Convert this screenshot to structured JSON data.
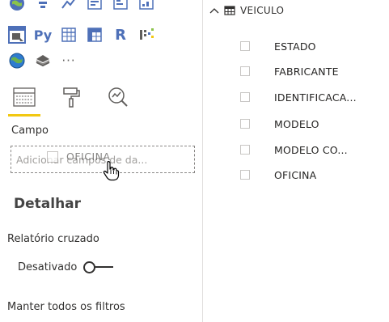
{
  "visualizations": {
    "row1": [
      "map-icon",
      "funnel-icon",
      "key-influencers-icon",
      "card-icon",
      "multirow-card-icon",
      "kpi-icon"
    ],
    "row2": [
      "slicer-icon",
      "python-visual-icon",
      "table-icon",
      "matrix-icon",
      "r-visual-icon",
      "decomposition-tree-icon"
    ],
    "row3": [
      "arcgis-map-icon",
      "shape-map-icon",
      "more-visuals-icon"
    ],
    "py_label": "Py",
    "r_label": "R",
    "more_label": "···"
  },
  "tabs": [
    {
      "name": "fields-tab",
      "icon": "fields-icon"
    },
    {
      "name": "format-tab",
      "icon": "paint-roller-icon"
    },
    {
      "name": "analytics-tab",
      "icon": "magnifier-chart-icon"
    }
  ],
  "field_well": {
    "label": "Campo",
    "placeholder": "Adicionar campos de da...",
    "drag_item": "OFICINA"
  },
  "drillthrough": {
    "title": "Detalhar",
    "cross_report_label": "Relatório cruzado",
    "toggle_label": "Desativado",
    "keep_filters_label": "Manter todos os filtros"
  },
  "fields_pane": {
    "table_name": "VEICULO",
    "fields": [
      {
        "label": "ESTADO"
      },
      {
        "label": "FABRICANTE"
      },
      {
        "label": "IDENTIFICACA..."
      },
      {
        "label": "MODELO"
      },
      {
        "label": "MODELO CO..."
      },
      {
        "label": "OFICINA"
      }
    ]
  },
  "colors": {
    "accent": "#f2c811",
    "viz_blue": "#4e70b8",
    "text": "#252423",
    "border": "#c8c6c4"
  }
}
